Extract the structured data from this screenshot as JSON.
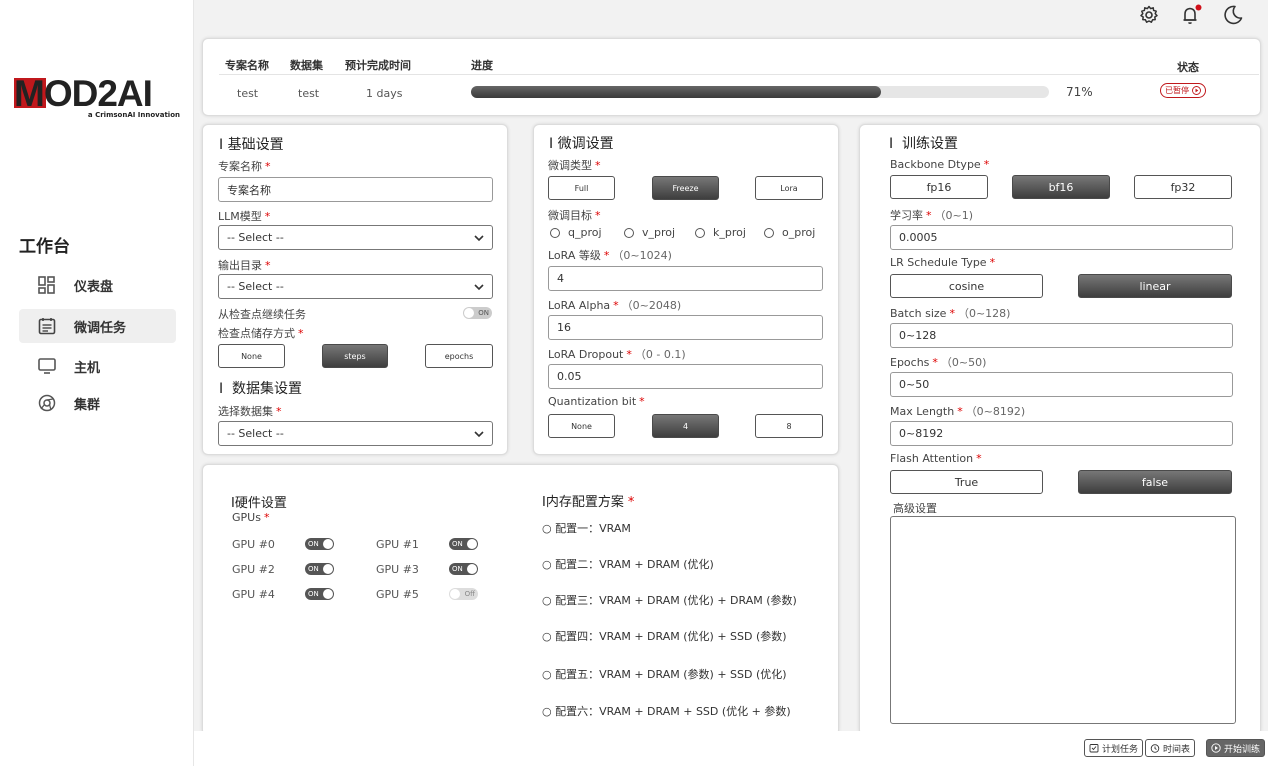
{
  "brand": {
    "logo_text": "MOD2AI",
    "tagline": "a CrimsonAI Innovation"
  },
  "sidebar": {
    "title": "工作台",
    "items": [
      {
        "label": "仪表盘",
        "icon": "dashboard-icon"
      },
      {
        "label": "微调任务",
        "icon": "task-list-icon",
        "active": true
      },
      {
        "label": "主机",
        "icon": "monitor-icon"
      },
      {
        "label": "集群",
        "icon": "cluster-icon"
      }
    ]
  },
  "topbar": {
    "icons": [
      "gear-icon",
      "bell-icon",
      "moon-icon"
    ],
    "notification_dot": true
  },
  "project_table": {
    "headers": {
      "name": "专案名称",
      "dataset": "数据集",
      "eta": "预计完成时间",
      "progress": "进度",
      "status": "状态"
    },
    "row": {
      "name": "test",
      "dataset": "test",
      "eta": "1 days",
      "progress": 0.71,
      "progress_text": "71%",
      "status": "已暂停"
    }
  },
  "basic": {
    "title": "基础设置",
    "project_name_label": "专案名称",
    "project_name_value": "专案名称",
    "llm_label": "LLM模型",
    "llm_value": "-- Select --",
    "output_label": "输出目录",
    "output_value": "-- Select --",
    "resume_label": "从检查点继续任务",
    "resume_toggle": "ON",
    "ckpt_label": "检查点储存方式",
    "ckpt_options": [
      "None",
      "steps",
      "epochs"
    ],
    "ckpt_selected": "steps",
    "dataset_title": "数据集设置",
    "dataset_label": "选择数据集",
    "dataset_value": "-- Select --"
  },
  "finetune": {
    "title": "微调设置",
    "type_label": "微调类型",
    "types": [
      "Full",
      "Freeze",
      "Lora"
    ],
    "type_selected": "Freeze",
    "target_label": "微调目标",
    "targets": [
      "q_proj",
      "v_proj",
      "k_proj",
      "o_proj"
    ],
    "rank_label": "LoRA 等级",
    "rank_range": "（0~1024)",
    "rank_value": "4",
    "alpha_label": "LoRA Alpha",
    "alpha_range": "（0~2048)",
    "alpha_value": "16",
    "dropout_label": "LoRA Dropout",
    "dropout_range": "（0 - 0.1)",
    "dropout_value": "0.05",
    "quant_label": "Quantization bit",
    "quant_options": [
      "None",
      "4",
      "8"
    ],
    "quant_selected": "4"
  },
  "training": {
    "title": "训练设置",
    "dtype_label": "Backbone Dtype",
    "dtypes": [
      "fp16",
      "bf16",
      "fp32"
    ],
    "dtype_selected": "bf16",
    "lr_label": "学习率",
    "lr_range": "（0~1)",
    "lr_value": "0.0005",
    "sched_label": "LR Schedule Type",
    "scheds": [
      "cosine",
      "linear"
    ],
    "sched_selected": "linear",
    "batch_label": "Batch size",
    "batch_range": "（0~128)",
    "batch_value": "0~128",
    "epochs_label": "Epochs",
    "epochs_range": "（0~50)",
    "epochs_value": "0~50",
    "maxlen_label": "Max Length",
    "maxlen_range": "（0~8192)",
    "maxlen_value": "0~8192",
    "flash_label": "Flash Attention",
    "flash_options": [
      "True",
      "false"
    ],
    "flash_selected": "false",
    "advanced_label": "高级设置",
    "advanced_value": ""
  },
  "hardware": {
    "title": "硬件设置",
    "gpus_label": "GPUs",
    "gpus": [
      {
        "label": "GPU #0",
        "state": "ON"
      },
      {
        "label": "GPU #1",
        "state": "ON"
      },
      {
        "label": "GPU #2",
        "state": "ON"
      },
      {
        "label": "GPU #3",
        "state": "ON"
      },
      {
        "label": "GPU #4",
        "state": "ON"
      },
      {
        "label": "GPU #5",
        "state": "Off"
      }
    ]
  },
  "memory": {
    "title": "内存配置方案",
    "options": [
      "配置一：VRAM",
      "配置二：VRAM + DRAM (优化)",
      "配置三：VRAM + DRAM (优化) + DRAM (参数)",
      "配置四：VRAM + DRAM (优化) + SSD (参数)",
      "配置五：VRAM + DRAM (参数) + SSD (优化)",
      "配置六：VRAM + DRAM + SSD (优化 + 参数)"
    ]
  },
  "footer": {
    "plan": "计划任务",
    "schedule": "时间表",
    "start": "开始训练"
  }
}
